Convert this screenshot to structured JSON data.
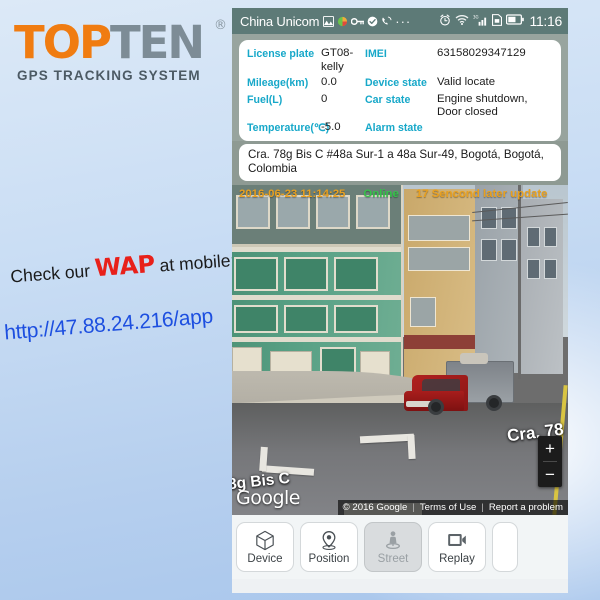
{
  "brand": {
    "logo_top": "TOP",
    "logo_ten": "TEN",
    "registered_mark": "®",
    "tagline": "GPS TRACKING SYSTEM"
  },
  "promo": {
    "line_prefix": "Check our ",
    "line_highlight": "WAP",
    "line_suffix": " at mobile:",
    "url": "http://47.88.24.216/app",
    "highlight_color": "#E8201A",
    "url_color": "#1D4FE0"
  },
  "statusbar": {
    "carrier": "China Unicom",
    "time": "11:16",
    "network": "3G",
    "icons": [
      "screenshot-icon",
      "qq-icon",
      "key-icon",
      "check-circle-icon",
      "phone-icon",
      "more-dots-icon",
      "alarm-icon",
      "wifi-icon",
      "signal-icon",
      "sim-card-icon",
      "battery-icon"
    ],
    "dots": "···"
  },
  "info": {
    "rows": [
      {
        "label_left": "License plate",
        "value_left": "GT08-kelly",
        "label_right": "IMEI",
        "value_right": "63158029347129"
      },
      {
        "label_left": "Mileage(km)",
        "value_left": "0.0",
        "label_right": "Device state",
        "value_right": "Valid locate"
      },
      {
        "label_left": "Fuel(L)",
        "value_left": "0",
        "label_right": "Car state",
        "value_right": "Engine shutdown, Door closed"
      },
      {
        "label_left": "Temperature(℃)",
        "value_left": "-5.0",
        "label_right": "Alarm state",
        "value_right": ""
      }
    ],
    "label_color": "#17A8C9"
  },
  "address": {
    "text": "Cra. 78g Bis C #48a Sur-1 a 48a Sur-49, Bogotá, Bogotá, Colombia"
  },
  "statusline": {
    "timestamp": "2016-06-23 11:14:25",
    "online": "Online",
    "update": "17 Sencond later update",
    "time_color": "#E8A020",
    "online_color": "#36C24A"
  },
  "streetview": {
    "label_street_right": "Cra. 78",
    "label_street_left": "8g Bis C",
    "google_logo": "Google",
    "copyright": "© 2016 Google",
    "terms": "Terms of Use",
    "report": "Report a problem",
    "zoom_in": "+",
    "zoom_out": "−",
    "separator": "|"
  },
  "nav": {
    "items": [
      {
        "label": "Device",
        "icon": "cube-icon",
        "active": false
      },
      {
        "label": "Position",
        "icon": "map-pin-icon",
        "active": false
      },
      {
        "label": "Street",
        "icon": "pegman-icon",
        "active": true
      },
      {
        "label": "Replay",
        "icon": "video-icon",
        "active": false
      }
    ]
  }
}
